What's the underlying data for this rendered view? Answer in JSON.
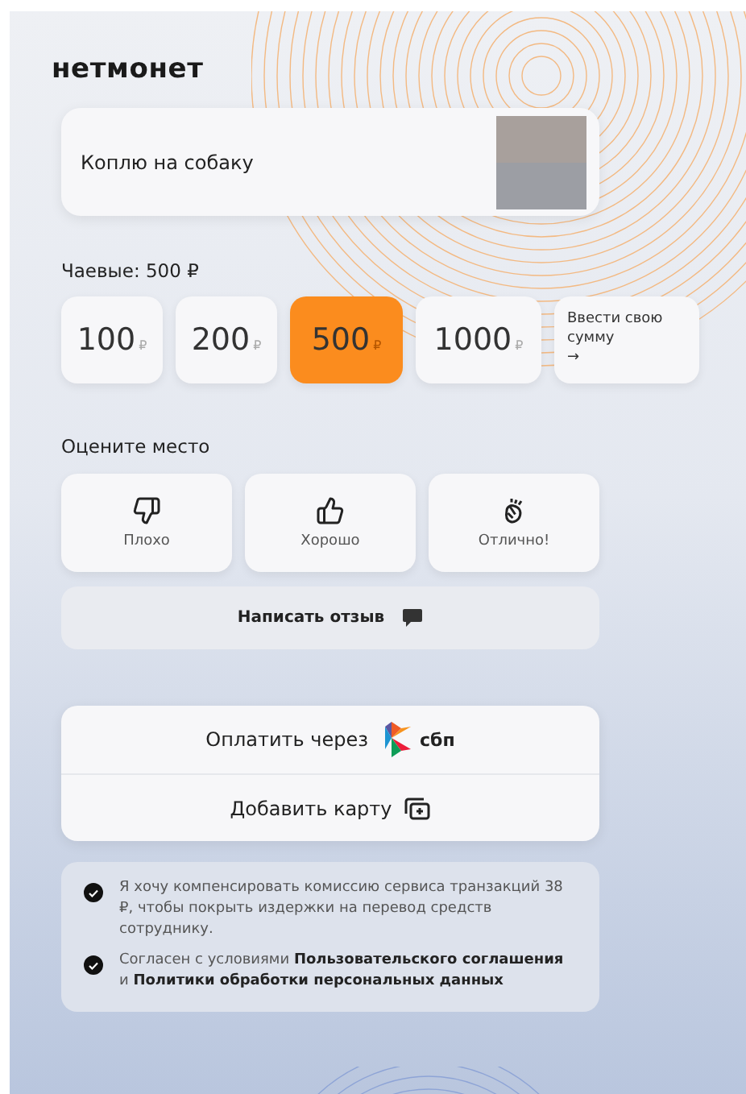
{
  "logo": "нетмонет",
  "goal": {
    "title": "Коплю на собаку"
  },
  "tips": {
    "label": "Чаевые: 500 ₽",
    "options": [
      {
        "amount": "100",
        "currency": "₽",
        "selected": false
      },
      {
        "amount": "200",
        "currency": "₽",
        "selected": false
      },
      {
        "amount": "500",
        "currency": "₽",
        "selected": true
      },
      {
        "amount": "1000",
        "currency": "₽",
        "selected": false
      }
    ],
    "custom": {
      "label": "Ввести свою сумму",
      "arrow": "→"
    }
  },
  "rating": {
    "label": "Оцените место",
    "options": [
      {
        "kind": "dislike",
        "label": "Плохо"
      },
      {
        "kind": "like",
        "label": "Хорошо"
      },
      {
        "kind": "clap",
        "label": "Отлично!"
      }
    ],
    "review": "Написать отзыв"
  },
  "payment": [
    {
      "kind": "sbp",
      "label": "Оплатить через",
      "brand": "сбп"
    },
    {
      "kind": "card",
      "label": "Добавить карту"
    }
  ],
  "consents": [
    {
      "text": "Я хочу компенсировать комиссию сервиса транзакций 38 ₽, чтобы покрыть издержки на перевод средств сотруднику.",
      "checked": true
    },
    {
      "text": "Согласен с условиями **Пользовательского соглашения** и **Политики обработки персональных данных**",
      "checked": true
    }
  ]
}
